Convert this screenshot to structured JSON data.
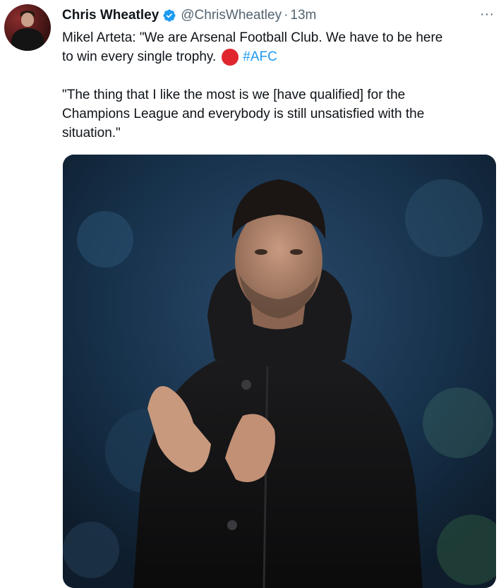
{
  "tweet": {
    "author_name": "Chris Wheatley",
    "author_handle": "@ChrisWheatley",
    "separator": "·",
    "timestamp": "13m",
    "more_label": "···",
    "text_line1": "Mikel Arteta: \"We are Arsenal Football Club. We have to be here",
    "text_line2": "to win every single trophy.",
    "hashtag": "#AFC",
    "quote_line1": "\"The thing that I like the most is we [have qualified] for the",
    "quote_line2": "Champions League and everybody is still unsatisfied with the",
    "quote_line3": "situation.\""
  },
  "colors": {
    "text": "#0f1419",
    "secondary": "#536471",
    "link": "#1d9bf0",
    "verified": "#1d9bf0",
    "red_dot": "#e0252f"
  },
  "icons": {
    "verified": "verified-badge-icon",
    "more": "more-options-icon",
    "emoji": "red-circle-emoji"
  }
}
